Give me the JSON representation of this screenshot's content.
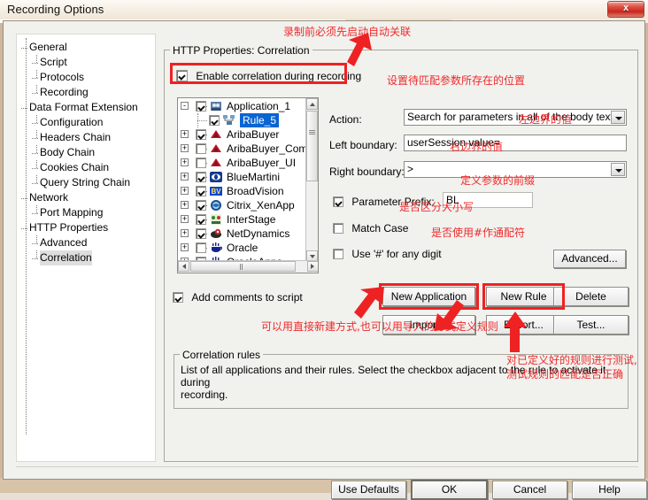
{
  "window": {
    "title": "Recording Options",
    "close_label": "x"
  },
  "left_tree": {
    "items": [
      {
        "label": "General",
        "indent": 0
      },
      {
        "label": "Script",
        "indent": 1
      },
      {
        "label": "Protocols",
        "indent": 1
      },
      {
        "label": "Recording",
        "indent": 1
      },
      {
        "label": "Data Format Extension",
        "indent": 0
      },
      {
        "label": "Configuration",
        "indent": 1
      },
      {
        "label": "Headers Chain",
        "indent": 1
      },
      {
        "label": "Body Chain",
        "indent": 1
      },
      {
        "label": "Cookies Chain",
        "indent": 1
      },
      {
        "label": "Query String Chain",
        "indent": 1
      },
      {
        "label": "Network",
        "indent": 0
      },
      {
        "label": "Port Mapping",
        "indent": 1
      },
      {
        "label": "HTTP Properties",
        "indent": 0
      },
      {
        "label": "Advanced",
        "indent": 1
      },
      {
        "label": "Correlation",
        "indent": 1,
        "selected": true
      }
    ]
  },
  "group": {
    "title": "HTTP Properties: Correlation",
    "enable_checkbox": {
      "label": "Enable correlation during recording",
      "checked": true
    }
  },
  "rule_tree": {
    "rows": [
      {
        "label": "Application_1",
        "checked": true,
        "expander": "-",
        "icon": "application-icon",
        "child": false
      },
      {
        "label": "Rule_5",
        "checked": true,
        "expander": "",
        "icon": "rule-icon",
        "child": true,
        "highlighted": true
      },
      {
        "label": "AribaBuyer",
        "checked": true,
        "expander": "+",
        "icon": "ariba-icon",
        "child": false
      },
      {
        "label": "AribaBuyer_Comr",
        "checked": false,
        "expander": "+",
        "icon": "ariba-icon",
        "child": false
      },
      {
        "label": "AribaBuyer_UI",
        "checked": false,
        "expander": "+",
        "icon": "ariba-icon",
        "child": false
      },
      {
        "label": "BlueMartini",
        "checked": true,
        "expander": "+",
        "icon": "bluemartini-icon",
        "child": false
      },
      {
        "label": "BroadVision",
        "checked": true,
        "expander": "+",
        "icon": "broadvision-icon",
        "child": false
      },
      {
        "label": "Citrix_XenApp",
        "checked": true,
        "expander": "+",
        "icon": "citrix-icon",
        "child": false
      },
      {
        "label": "InterStage",
        "checked": true,
        "expander": "+",
        "icon": "interstage-icon",
        "child": false
      },
      {
        "label": "NetDynamics",
        "checked": true,
        "expander": "+",
        "icon": "netdynamics-icon",
        "child": false
      },
      {
        "label": "Oracle",
        "checked": false,
        "expander": "+",
        "icon": "oracle-icon",
        "child": false
      },
      {
        "label": "OracleApps",
        "checked": false,
        "expander": "+",
        "icon": "oracle-icon",
        "child": false
      }
    ]
  },
  "form": {
    "action_label": "Action:",
    "action_value": "Search for parameters in all of the body text",
    "left_boundary_label": "Left boundary:",
    "left_boundary_value": "userSession value=",
    "right_boundary_label": "Right boundary:",
    "right_boundary_value": ">",
    "parameter_prefix_label": "Parameter Prefix:",
    "parameter_prefix_checked": true,
    "parameter_prefix_value": "BL",
    "match_case_label": "Match Case",
    "match_case_checked": false,
    "any_digit_label": "Use '#' for any digit",
    "any_digit_checked": false,
    "advanced_button": "Advanced..."
  },
  "actions": {
    "add_comments_label": "Add comments to script",
    "add_comments_checked": true,
    "new_application": "New Application",
    "new_rule": "New Rule",
    "delete": "Delete",
    "import": "Import...",
    "export": "Export...",
    "test": "Test..."
  },
  "correlation_rules": {
    "title": "Correlation rules",
    "description_line1": "List of all applications and their rules. Select the checkbox adjacent to the rule to activate it during",
    "description_line2": "recording."
  },
  "footer": {
    "use_defaults": "Use Defaults",
    "ok": "OK",
    "cancel": "Cancel",
    "help": "Help"
  },
  "annotations": {
    "top": "录制前必须先启动自动关联",
    "action": "设置待匹配参数所存在的位置",
    "left_boundary": "左边界的值",
    "right_boundary": "右边界的值",
    "param_prefix": "定义参数的前缀",
    "match_case": "是否区分大小写",
    "any_digit": "是否使用#作通配符",
    "rules_define": "可以用直接新建方式,也可以用导入的方式定义规则",
    "test_line1": "对已定义好的规则进行测试,",
    "test_line2": "测试规则的匹配是否正确"
  },
  "colors": {
    "annotation_red": "#ee2b2b",
    "selection_blue": "#0a64d2",
    "dialog_face": "#f1f1ee"
  }
}
